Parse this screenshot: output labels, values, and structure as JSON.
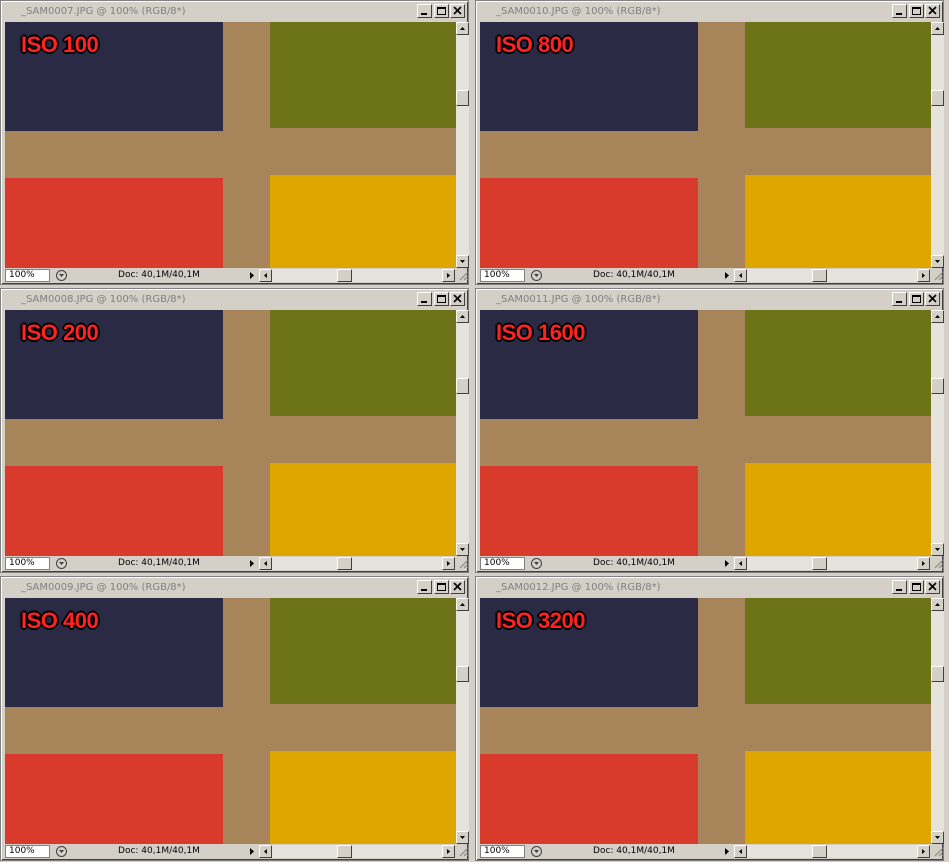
{
  "windows": [
    {
      "title": "_SAM0007.JPG @ 100% (RGB/8*)",
      "iso_label": "ISO 100",
      "zoom": "100%",
      "doc_info": "Doc: 40,1M/40,1M"
    },
    {
      "title": "_SAM0010.JPG @ 100% (RGB/8*)",
      "iso_label": "ISO 800",
      "zoom": "100%",
      "doc_info": "Doc: 40,1M/40,1M"
    },
    {
      "title": "_SAM0008.JPG @ 100% (RGB/8*)",
      "iso_label": "ISO 200",
      "zoom": "100%",
      "doc_info": "Doc: 40,1M/40,1M"
    },
    {
      "title": "_SAM0011.JPG @ 100% (RGB/8*)",
      "iso_label": "ISO 1600",
      "zoom": "100%",
      "doc_info": "Doc: 40,1M/40,1M"
    },
    {
      "title": "_SAM0009.JPG @ 100% (RGB/8*)",
      "iso_label": "ISO 400",
      "zoom": "100%",
      "doc_info": "Doc: 40,1M/40,1M"
    },
    {
      "title": "_SAM0012.JPG @ 100% (RGB/8*)",
      "iso_label": "ISO 3200",
      "zoom": "100%",
      "doc_info": "Doc: 40,1M/40,1M"
    }
  ],
  "colors": {
    "swatch_navy": "#2b2a45",
    "swatch_olive": "#6d7418",
    "swatch_red": "#d83a2b",
    "swatch_yellow": "#dfa600",
    "background_tan": "#a8845a",
    "label_red": "#ff2222"
  },
  "icons": {
    "minimize": "minimize-icon",
    "maximize": "maximize-icon",
    "close": "close-icon",
    "scroll_up": "arrow-up-icon",
    "scroll_down": "arrow-down-icon",
    "scroll_left": "arrow-left-icon",
    "scroll_right": "arrow-right-icon",
    "status_menu": "status-menu-icon",
    "resize": "resize-grip-icon"
  }
}
